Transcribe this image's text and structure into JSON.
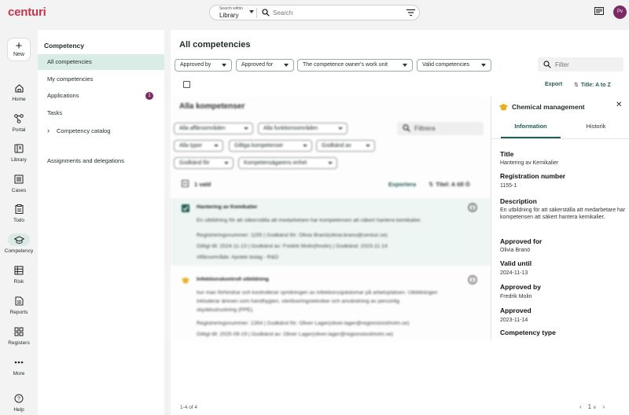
{
  "app": {
    "logo": "centuri",
    "avatar_initials": "Pv"
  },
  "search": {
    "scope_caption": "Search within",
    "scope_value": "Library",
    "placeholder": "Search"
  },
  "rail": {
    "new_label": "New",
    "items": [
      {
        "label": "Home",
        "icon": "home-icon"
      },
      {
        "label": "Portal",
        "icon": "portal-icon"
      },
      {
        "label": "Library",
        "icon": "library-icon"
      },
      {
        "label": "Cases",
        "icon": "cases-icon"
      },
      {
        "label": "Todo",
        "icon": "todo-icon"
      },
      {
        "label": "Competency",
        "icon": "graduation-cap-icon"
      },
      {
        "label": "Risk",
        "icon": "risk-icon"
      },
      {
        "label": "Reports",
        "icon": "reports-icon"
      },
      {
        "label": "Registers",
        "icon": "registers-icon"
      },
      {
        "label": "More",
        "icon": "more-icon"
      },
      {
        "label": "Help",
        "icon": "help-icon"
      }
    ]
  },
  "subnav": {
    "title": "Competency",
    "items": [
      "All competencies",
      "My competencies",
      "Applications",
      "Tasks",
      "Competency catalog",
      "Assignments and delegations"
    ],
    "applications_badge": "1"
  },
  "main": {
    "title": "All competencies",
    "filters": [
      "Approved by",
      "Approved for",
      "The competence owner's work unit",
      "Valid competencies"
    ],
    "filter_placeholder": "Filter",
    "export_label": "Export",
    "sort_label": "Title: A to Z",
    "pager_text": "1-4 of 4",
    "page_value": "1"
  },
  "embedded": {
    "title": "Alla kompetenser",
    "filters_row1": [
      "Alla affärsområden",
      "Alla funktionsområden"
    ],
    "filters_row2": [
      "Alla typer",
      "Giltiga kompetenser",
      "Godkänd av"
    ],
    "filters_row3": [
      "Godkänd för",
      "Kompetensägarens enhet"
    ],
    "filter_placeholder": "Filtrera",
    "selected_text": "1 vald",
    "export_label": "Exportera",
    "sort_label": "Titel: A till Ö",
    "rows": [
      {
        "title": "Hantering av Kemikalier",
        "description": "En utbildning för att säkerställa att medarbetare har kompetensen att säkert hantera kemikalier.",
        "meta1": "Registreringsnummer: 1155 | Godkänd för: Olivia Branö(olivia.brano@centuri.se)",
        "meta2": "Giltigt till: 2024-11-13 | Godkänd av: Fredrik Molin(fmolin) | Godkänd: 2023-11-14",
        "meta3": "Affärsområde: Apotek bolag - R&D"
      },
      {
        "title": "Infektionskontroll utbildning",
        "description1": "hur man förhindrar och kontrollerar spridningen av infektionssjukdomar på arbetsplatsen. Utbildningen",
        "description2": "inkluderar ämnen som handhygien, steriliseringstekniker och användning av personlig",
        "description3": "skyddsutrustning (PPE).",
        "meta1": "Registreringsnummer: 1264 | Godkänd för: Oliver Lager(oliver.lager@regionstockholm.se)",
        "meta2": "Giltigt till: 2025-08-19 | Godkänd av: Oliver Lager(oliver.lager@regionstockholm.se)"
      }
    ]
  },
  "detail": {
    "title": "Chemical management",
    "tabs": [
      "Information",
      "Historik"
    ],
    "fields": [
      {
        "label": "Title",
        "value": "Hantering av Kemikalier"
      },
      {
        "label": "Registration number",
        "value": "1155-1"
      },
      {
        "label": "Description",
        "value": "En utbildning för att säkerställa att medarbetare har kompetensen att säkert hantera kemikalier."
      },
      {
        "label": "Approved for",
        "value": "Olivia Branö"
      },
      {
        "label": "Valid until",
        "value": "2024-11-13"
      },
      {
        "label": "Approved by",
        "value": "Fredrik Molin"
      },
      {
        "label": "Approved",
        "value": "2023-11-14"
      },
      {
        "label": "Competency type",
        "value": ""
      }
    ]
  },
  "colors": {
    "brand": "#c8344e",
    "accent": "#1f5c52",
    "badge": "#7b2a63",
    "active_bg": "#d9ece6"
  }
}
